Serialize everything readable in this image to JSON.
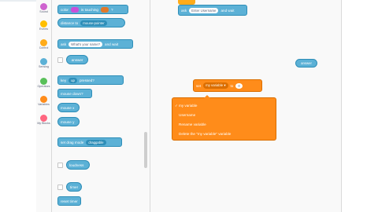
{
  "categories": [
    {
      "label": "Sound",
      "color": "#cf63cf",
      "icon": "sound-dot-icon"
    },
    {
      "label": "Events",
      "color": "#ffbf00",
      "icon": "events-dot-icon"
    },
    {
      "label": "Control",
      "color": "#ffab19",
      "icon": "control-dot-icon"
    },
    {
      "label": "Sensing",
      "color": "#5cb1d6",
      "icon": "sensing-dot-icon"
    },
    {
      "label": "Operators",
      "color": "#59c059",
      "icon": "operators-dot-icon"
    },
    {
      "label": "Variables",
      "color": "#ff8c1a",
      "icon": "variables-dot-icon"
    },
    {
      "label": "My Blocks",
      "color": "#ff6680",
      "icon": "myblocks-dot-icon"
    }
  ],
  "palette": {
    "color_touching": {
      "left": "color",
      "mid": "is touching",
      "right": "?"
    },
    "distance_to": {
      "label": "distance to",
      "target": "mouse-pointer"
    },
    "ask": {
      "label": "ask",
      "question": "What's your name?",
      "suffix": "and wait"
    },
    "answer": "answer",
    "key_pressed": {
      "label": "key",
      "key": "up",
      "suffix": "pressed?"
    },
    "mouse_down": "mouse down?",
    "mouse_x": "mouse x",
    "mouse_y": "mouse y",
    "drag_mode": {
      "label": "set drag mode",
      "value": "draggable"
    },
    "loudness": "loudness",
    "timer": "timer",
    "reset_timer": "reset timer"
  },
  "canvas": {
    "ask_block": {
      "label": "ask",
      "value": "Enter Username",
      "suffix": "and wait"
    },
    "set_block": {
      "label": "set",
      "var": "my variable",
      "to": "to",
      "value": "0"
    },
    "floating_block": "answer",
    "dropdown_menu": {
      "items": [
        "my variable",
        "Username",
        "Rename variable",
        "Delete the \"my variable\" variable"
      ],
      "selected_index": 0
    }
  }
}
